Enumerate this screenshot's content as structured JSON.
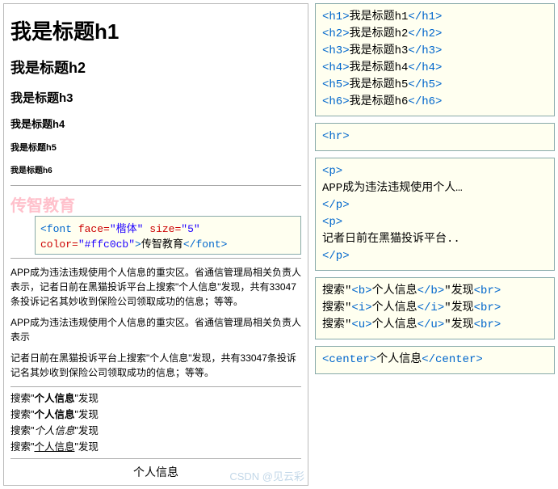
{
  "headings": {
    "h1": "我是标题h1",
    "h2": "我是标题h2",
    "h3": "我是标题h3",
    "h4": "我是标题h4",
    "h5": "我是标题h5",
    "h6": "我是标题h6"
  },
  "font_demo_text": "传智教育",
  "font_code": {
    "open": "<font face=\"楷体\" size=\"5\" color=\"#ffc0cb\">",
    "text": "传智教育",
    "close": "</font>"
  },
  "para1": "APP成为违法违规使用个人信息的重灾区。省通信管理局相关负责人表示，记者日前在黑猫投诉平台上搜索\"个人信息\"发现，共有33047条投诉记名其妙收到保险公司领取成功的信息；等等。",
  "para2a": "APP成为违法违规使用个人信息的重灾区。省通信管理局相关负责人表示",
  "para2b": "记者日前在黑猫投诉平台上搜索\"个人信息\"发现，共有33047条投诉记名其妙收到保险公司领取成功的信息；等等。",
  "search": {
    "prefix": "搜索\"",
    "term": "个人信息",
    "suffix": "\"发现"
  },
  "center_text": "个人信息",
  "code_headings": "<h1>我是标题h1</h1>\n<h2>我是标题h2</h2>\n<h3>我是标题h3</h3>\n<h4>我是标题h4</h4>\n<h5>我是标题h5</h5>\n<h6>我是标题h6</h6>",
  "code_hr": "<hr>",
  "code_para": {
    "l1": "<p>",
    "l2": "APP成为违法违规使用个人…",
    "l3": "</p>",
    "l4": "<p>",
    "l5": "记者日前在黑猫投诉平台..",
    "l6": "</p>"
  },
  "code_search": {
    "line_b": "搜索\"<b>个人信息</b>\"发现<br>",
    "line_i": "搜索\"<i>个人信息</i>\"发现<br>",
    "line_u": "搜索\"<u>个人信息</u>\"发现<br>"
  },
  "code_center": "<center>个人信息</center>",
  "watermark": "CSDN @见云彩"
}
